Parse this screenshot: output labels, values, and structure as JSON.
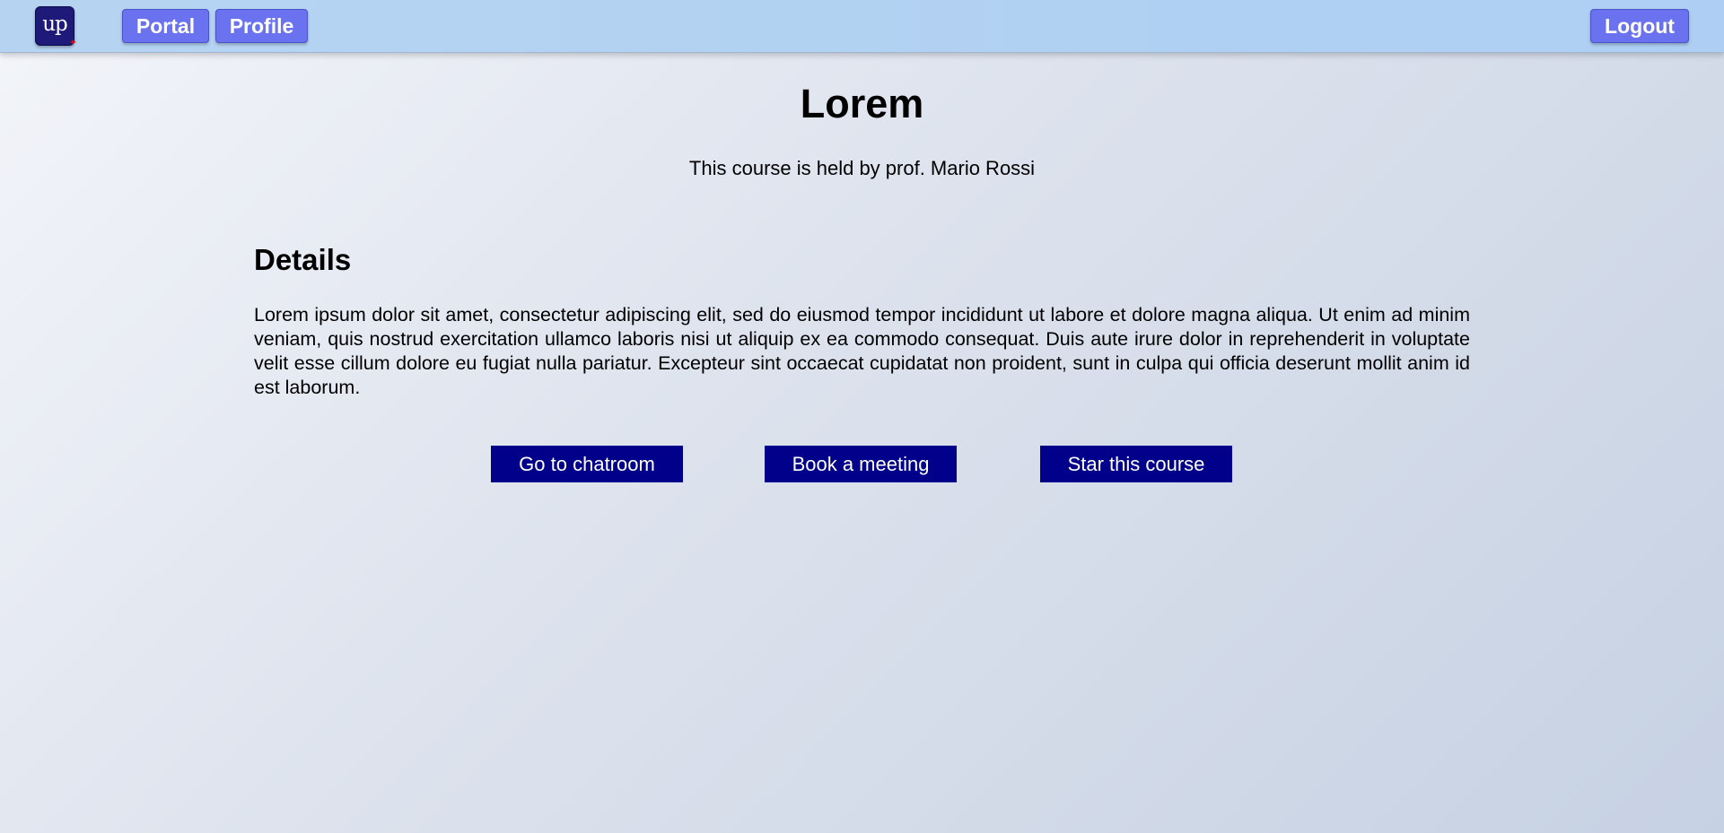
{
  "header": {
    "logo_text": "up",
    "nav": {
      "portal_label": "Portal",
      "profile_label": "Profile",
      "logout_label": "Logout"
    }
  },
  "course": {
    "title": "Lorem",
    "subtitle": "This course is held by prof. Mario Rossi",
    "details_heading": "Details",
    "details_text": "Lorem ipsum dolor sit amet, consectetur adipiscing elit, sed do eiusmod tempor incididunt ut labore et dolore magna aliqua. Ut enim ad minim veniam, quis nostrud exercitation ullamco laboris nisi ut aliquip ex ea commodo consequat. Duis aute irure dolor in reprehenderit in voluptate velit esse cillum dolore eu fugiat nulla pariatur. Excepteur sint occaecat cupidatat non proident, sunt in culpa qui officia deserunt mollit anim id est laborum."
  },
  "actions": {
    "chatroom_label": "Go to chatroom",
    "meeting_label": "Book a meeting",
    "star_label": "Star this course"
  },
  "colors": {
    "header_bg": "#b6d4f2",
    "nav_button_bg": "#6a72f0",
    "action_button_bg": "#00008b",
    "logo_bg": "#1e1a7a",
    "logo_star": "#d01010"
  },
  "icons": {
    "logo": "up-logo-icon",
    "logo_badge": "star-icon"
  }
}
